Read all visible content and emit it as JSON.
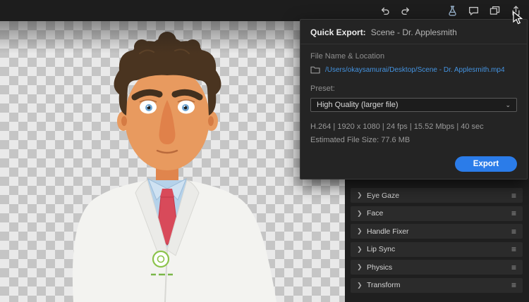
{
  "toolbar": {
    "icons": [
      "undo-icon",
      "redo-icon",
      "flask-icon",
      "comment-icon",
      "frames-icon",
      "share-icon"
    ]
  },
  "quick_export": {
    "title": "Quick Export:",
    "scene_name": "Scene - Dr. Applesmith",
    "file_section_label": "File Name & Location",
    "file_path": "/Users/okaysamurai/Desktop/Scene - Dr. Applesmith.mp4",
    "preset_label": "Preset:",
    "preset_value": "High Quality (larger file)",
    "dropdown_chevron": "⌄",
    "specs": "H.264 | 1920 x 1080 | 24 fps | 15.52 Mbps | 40 sec",
    "estimated_size": "Estimated File Size: 77.6 MB",
    "export_button": "Export"
  },
  "properties_panel": {
    "chevron": "❯",
    "menu_glyph": "≡",
    "sections": [
      {
        "label": "Eye Gaze"
      },
      {
        "label": "Face"
      },
      {
        "label": "Handle Fixer"
      },
      {
        "label": "Lip Sync"
      },
      {
        "label": "Physics"
      },
      {
        "label": "Transform"
      }
    ]
  },
  "colors": {
    "accent_blue": "#2b7ce9",
    "link_blue": "#4493e0",
    "panel_bg": "#242424",
    "checker_light": "#e9e9e9",
    "checker_dark": "#c5c5c5"
  }
}
